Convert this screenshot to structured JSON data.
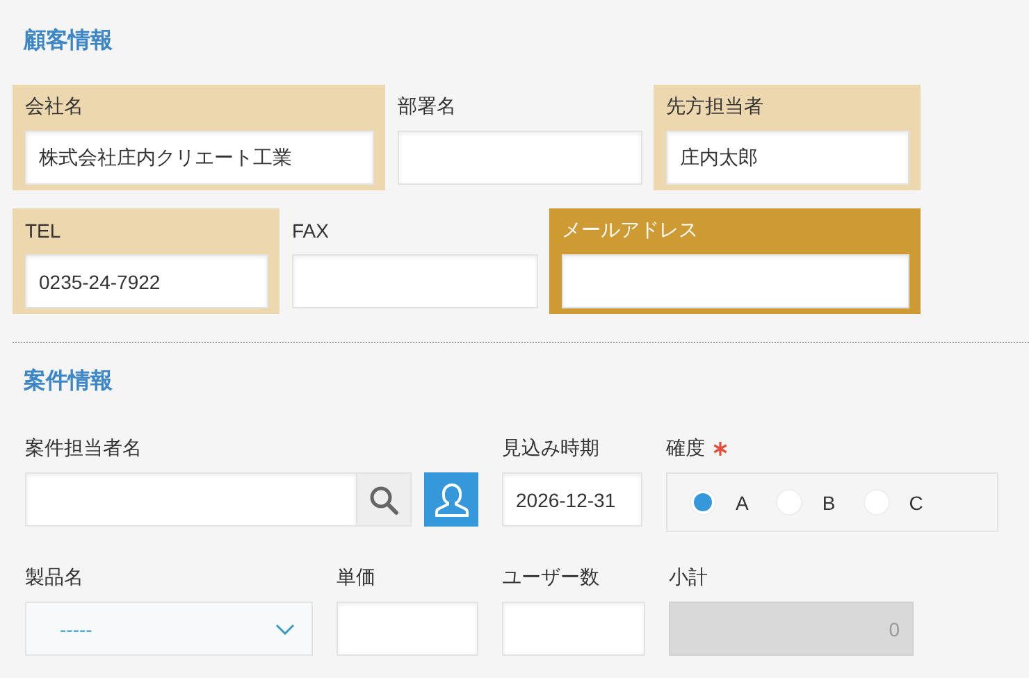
{
  "sections": [
    {
      "title": "顧客情報",
      "rows": [
        {
          "fields": [
            {
              "kind": "text",
              "label": "会社名",
              "value": "株式会社庄内クリエート工業",
              "color": "#ecd7ae"
            },
            {
              "kind": "text",
              "label": "部署名"
            },
            {
              "kind": "text",
              "label": "先方担当者",
              "value": "庄内太郎",
              "color": "#ecd7ae"
            }
          ]
        },
        {
          "fields": [
            {
              "kind": "text",
              "label": "TEL",
              "value": "0235-24-7922",
              "color": "#ecd7ae"
            },
            {
              "kind": "text",
              "label": "FAX"
            },
            {
              "kind": "text",
              "label": "メールアドレス",
              "color": "#cd9a33"
            }
          ]
        }
      ]
    },
    {
      "title": "案件情報",
      "rows": [
        {
          "fields": [
            {
              "kind": "user",
              "label": "案件担当者名"
            },
            {
              "kind": "date",
              "label": "見込み時期",
              "value": "2026-12-31"
            },
            {
              "kind": "radio",
              "label": "確度",
              "required": true,
              "options": [
                {
                  "label": "A",
                  "selected": true
                },
                {
                  "label": "B",
                  "selected": false
                },
                {
                  "label": "C",
                  "selected": false
                }
              ]
            }
          ]
        },
        {
          "fields": [
            {
              "kind": "select",
              "label": "製品名",
              "value": "-----"
            },
            {
              "kind": "text",
              "label": "単価"
            },
            {
              "kind": "text",
              "label": "ユーザー数"
            },
            {
              "kind": "calc",
              "label": "小計",
              "value": "0",
              "disabled": true
            }
          ]
        }
      ]
    }
  ]
}
